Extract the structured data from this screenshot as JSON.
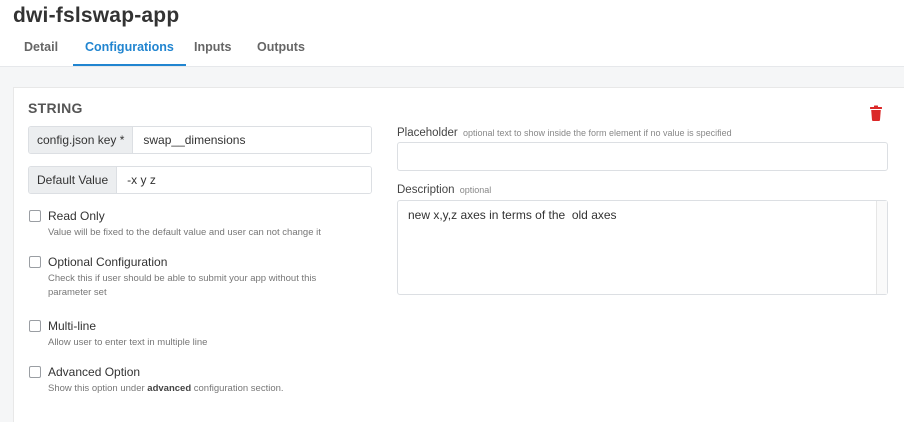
{
  "app": {
    "title": "dwi-fslswap-app"
  },
  "tabs": [
    {
      "label": "Detail",
      "active": false
    },
    {
      "label": "Configurations",
      "active": true
    },
    {
      "label": "Inputs",
      "active": false
    },
    {
      "label": "Outputs",
      "active": false
    }
  ],
  "config": {
    "type_label": "STRING",
    "key_field": {
      "label": "config.json key *",
      "value": "swap__dimensions"
    },
    "default_field": {
      "label": "Default Value",
      "value": "-x y z"
    },
    "options": [
      {
        "label": "Read Only",
        "hint": "Value will be fixed to the default value and user can not change it",
        "checked": false
      },
      {
        "label": "Optional Configuration",
        "hint": "Check this if user should be able to submit your app without this parameter set",
        "checked": false
      },
      {
        "label": "Multi-line",
        "hint": "Allow user to enter text in multiple line",
        "checked": false
      },
      {
        "label": "Advanced Option",
        "hint_prefix": "Show this option under ",
        "hint_bold": "advanced",
        "hint_suffix": " configuration section.",
        "checked": false
      }
    ],
    "placeholder_field": {
      "label": "Placeholder",
      "note": "optional text to show inside the form element if no value is specified",
      "value": ""
    },
    "description_field": {
      "label": "Description",
      "note": "optional",
      "value": "new x,y,z axes in terms of the  old axes"
    }
  },
  "icons": {
    "delete": "trash-icon"
  },
  "colors": {
    "accent": "#2185d0",
    "danger": "#db2828"
  }
}
